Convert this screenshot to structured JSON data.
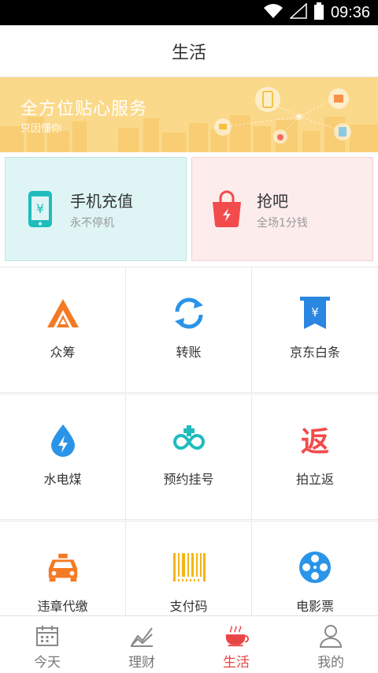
{
  "status_bar": {
    "time": "09:36"
  },
  "header": {
    "title": "生活"
  },
  "banner": {
    "headline": "全方位贴心服务",
    "subtitle": "只因懂你"
  },
  "promos": [
    {
      "name": "手机充值",
      "desc": "永不停机",
      "icon": "phone-yen-icon",
      "color": "#1fbcbc"
    },
    {
      "name": "抢吧",
      "desc": "全场1分钱",
      "icon": "shopping-bag-icon",
      "color": "#f24b4b"
    }
  ],
  "services": [
    {
      "label": "众筹",
      "icon": "crowdfunding-icon",
      "color": "#f47a24"
    },
    {
      "label": "转账",
      "icon": "transfer-icon",
      "color": "#2a94e8"
    },
    {
      "label": "京东白条",
      "icon": "baitiao-icon",
      "color": "#2a86e0"
    },
    {
      "label": "水电煤",
      "icon": "water-drop-icon",
      "color": "#2a94e8"
    },
    {
      "label": "预约挂号",
      "icon": "medical-appointment-icon",
      "color": "#1fbcbc"
    },
    {
      "label": "拍立返",
      "icon": "cashback-icon",
      "color": "#f24b4b"
    },
    {
      "label": "违章代缴",
      "icon": "taxi-icon",
      "color": "#f47a24"
    },
    {
      "label": "支付码",
      "icon": "barcode-icon",
      "color": "#f5b417"
    },
    {
      "label": "电影票",
      "icon": "film-reel-icon",
      "color": "#2a94e8"
    }
  ],
  "tabs": [
    {
      "label": "今天",
      "icon": "calendar-icon",
      "active": false
    },
    {
      "label": "理财",
      "icon": "chart-icon",
      "active": false
    },
    {
      "label": "生活",
      "icon": "coffee-cup-icon",
      "active": true
    },
    {
      "label": "我的",
      "icon": "user-icon",
      "active": false
    }
  ]
}
